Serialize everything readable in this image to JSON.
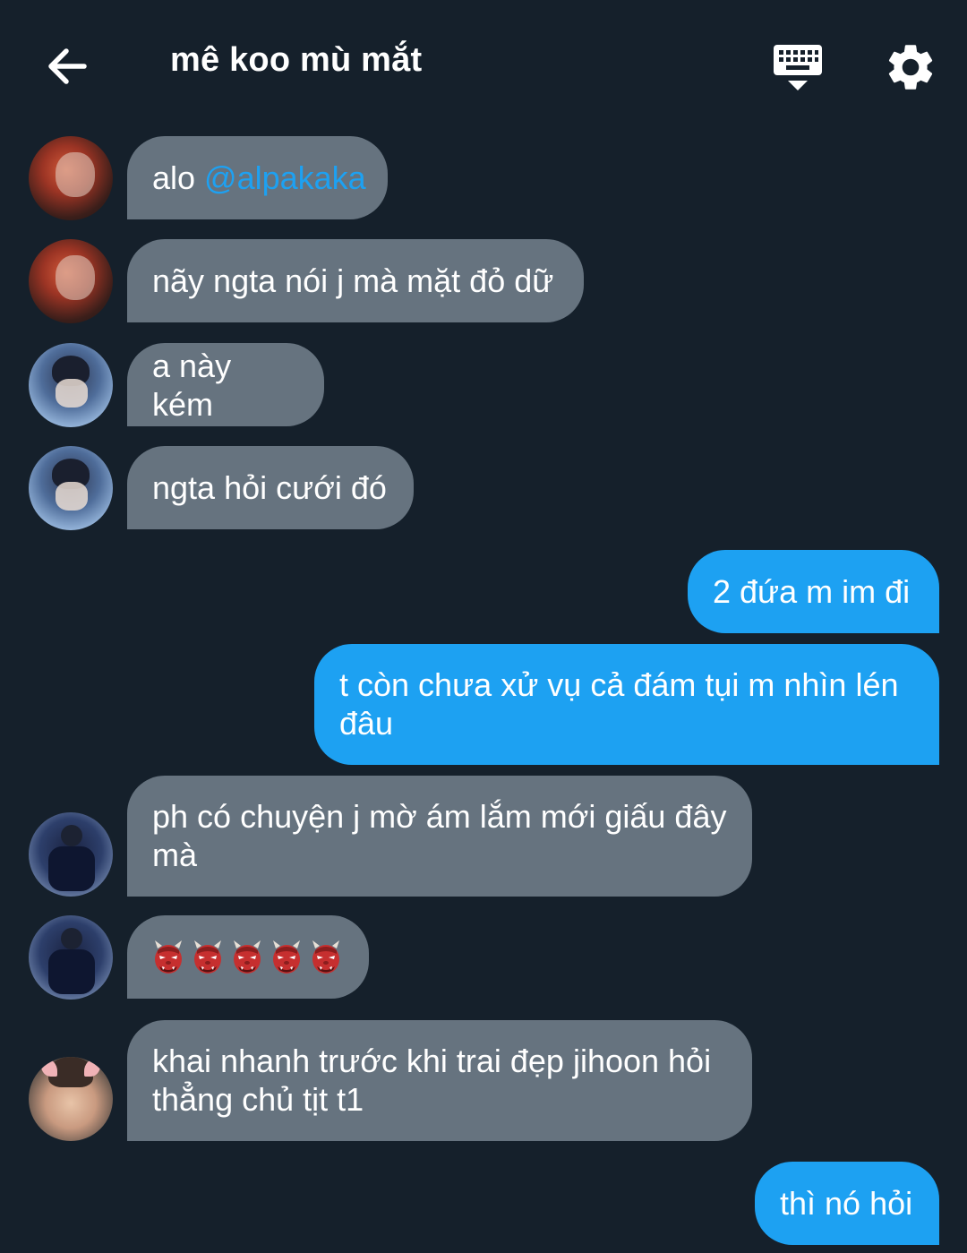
{
  "header": {
    "title": "mê koo mù mắt",
    "back_icon": "arrow-left-icon",
    "keyboard_icon": "keyboard-hide-icon",
    "settings_icon": "gear-icon"
  },
  "messages": [
    {
      "dir": "in",
      "text_prefix": "alo ",
      "mention": "@alpakaka"
    },
    {
      "dir": "in",
      "text": "nãy ngta nói j mà mặt đỏ dữ"
    },
    {
      "dir": "in",
      "text": "a này kém"
    },
    {
      "dir": "in",
      "text": "ngta hỏi cưới đó"
    },
    {
      "dir": "out",
      "text": "2 đứa m im đi"
    },
    {
      "dir": "out",
      "text": "t còn chưa xử vụ cả đám tụi m nhìn lén đâu"
    },
    {
      "dir": "in",
      "text": "ph có chuyện j mờ ám lắm mới giấu đây mà"
    },
    {
      "dir": "in",
      "emoji": "japanese-ogre-emoji",
      "emoji_count": 5
    },
    {
      "dir": "in",
      "text": "khai nhanh trước khi trai đẹp jihoon hỏi thẳng chủ tịt t1"
    },
    {
      "dir": "out",
      "text": "thì nó hỏi"
    }
  ],
  "colors": {
    "background": "#15202b",
    "incoming_bubble": "#66737f",
    "outgoing_bubble": "#1da1f2",
    "mention": "#1da1f2"
  }
}
